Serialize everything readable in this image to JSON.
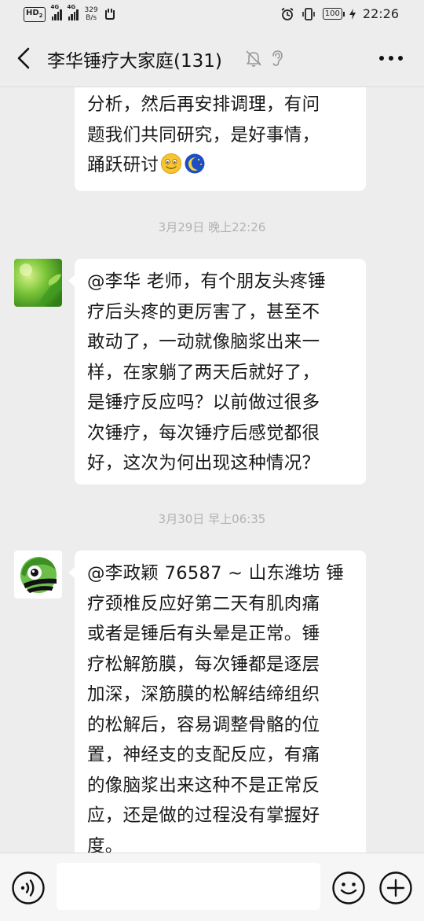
{
  "status_bar": {
    "hd": "HD",
    "hd_sub": "2",
    "sig1_tag": "4G",
    "sig2_tag": "4G",
    "speed_value": "329",
    "speed_unit": "B/s",
    "battery": "100",
    "time": "22:26"
  },
  "header": {
    "title": "李华锤疗大家庭(131)"
  },
  "messages": {
    "m1": {
      "lines": [
        "分析，然后再安排调理，有问",
        "题我们共同研究，是好事情，",
        "踊跃研讨"
      ],
      "emojis": [
        "smile-emoji",
        "moon-emoji"
      ]
    },
    "ts1": "3月29日 晚上22:26",
    "m2": {
      "lines": [
        "@李华  老师，有个朋友头疼锤",
        "疗后头疼的更厉害了，甚至不",
        "敢动了，一动就像脑浆出来一",
        "样，在家躺了两天后就好了，",
        "是锤疗反应吗？以前做过很多",
        "次锤疗，每次锤疗后感觉都很",
        "好，这次为何出现这种情况？"
      ]
    },
    "ts2": "3月30日 早上06:35",
    "m3": {
      "lines": [
        "@李政颖 76587 ~ 山东潍坊  锤",
        "疗颈椎反应好第二天有肌肉痛",
        "或者是锤后有头晕是正常。锤",
        "疗松解筋膜，每次锤都是逐层",
        "加深，深筋膜的松解结缔组织",
        "的松解后，容易调整骨骼的位",
        "置，神经支的支配反应，有痛",
        "的像脑浆出来这种不是正常反",
        "应，还是做的过程没有掌握好",
        "度。"
      ]
    }
  },
  "input": {
    "value": "",
    "placeholder": ""
  },
  "colors": {
    "background": "#ededed",
    "bubble": "#ffffff",
    "timestamp": "#b2b2b2"
  },
  "icons": [
    "back-icon",
    "mute-icon",
    "ear-icon",
    "more-icon",
    "voice-icon",
    "emoji-icon",
    "plus-icon"
  ]
}
